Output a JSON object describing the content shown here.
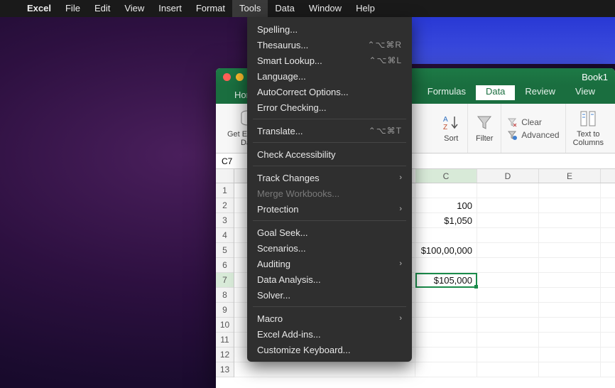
{
  "menubar": {
    "items": [
      "Excel",
      "File",
      "Edit",
      "View",
      "Insert",
      "Format",
      "Tools",
      "Data",
      "Window",
      "Help"
    ],
    "active": "Tools"
  },
  "dropdown": {
    "groups": [
      [
        {
          "label": "Spelling...",
          "shortcut": "",
          "sub": false
        },
        {
          "label": "Thesaurus...",
          "shortcut": "⌃⌥⌘R",
          "sub": false
        },
        {
          "label": "Smart Lookup...",
          "shortcut": "⌃⌥⌘L",
          "sub": false
        },
        {
          "label": "Language...",
          "shortcut": "",
          "sub": false
        },
        {
          "label": "AutoCorrect Options...",
          "shortcut": "",
          "sub": false
        },
        {
          "label": "Error Checking...",
          "shortcut": "",
          "sub": false
        }
      ],
      [
        {
          "label": "Translate...",
          "shortcut": "⌃⌥⌘T",
          "sub": false
        }
      ],
      [
        {
          "label": "Check Accessibility",
          "shortcut": "",
          "sub": false
        }
      ],
      [
        {
          "label": "Track Changes",
          "shortcut": "",
          "sub": true
        },
        {
          "label": "Merge Workbooks...",
          "shortcut": "",
          "sub": false,
          "disabled": true
        },
        {
          "label": "Protection",
          "shortcut": "",
          "sub": true
        }
      ],
      [
        {
          "label": "Goal Seek...",
          "shortcut": "",
          "sub": false
        },
        {
          "label": "Scenarios...",
          "shortcut": "",
          "sub": false
        },
        {
          "label": "Auditing",
          "shortcut": "",
          "sub": true
        },
        {
          "label": "Data Analysis...",
          "shortcut": "",
          "sub": false
        },
        {
          "label": "Solver...",
          "shortcut": "",
          "sub": false
        }
      ],
      [
        {
          "label": "Macro",
          "shortcut": "",
          "sub": true
        },
        {
          "label": "Excel Add-ins...",
          "shortcut": "",
          "sub": false
        },
        {
          "label": "Customize Keyboard...",
          "shortcut": "",
          "sub": false
        }
      ]
    ]
  },
  "window": {
    "title": "Book1",
    "tabs": {
      "left": "Hom",
      "items": [
        "Formulas",
        "Data",
        "Review",
        "View"
      ],
      "active": "Data"
    },
    "ribbon": {
      "getdata": "Get External\nData",
      "sort": "Sort",
      "filter": "Filter",
      "clear": "Clear",
      "advanced": "Advanced",
      "textcols": "Text to\nColumns"
    },
    "namebox": "C7",
    "columns": [
      "C",
      "D",
      "E"
    ],
    "rows": [
      "1",
      "2",
      "3",
      "4",
      "5",
      "6",
      "7",
      "8",
      "9",
      "10",
      "11",
      "12",
      "13"
    ],
    "cells": {
      "c2": "100",
      "c3": "$1,050",
      "c5": "$100,00,000",
      "c7": "$105,000"
    },
    "active": {
      "row": 7,
      "col": "C"
    }
  }
}
